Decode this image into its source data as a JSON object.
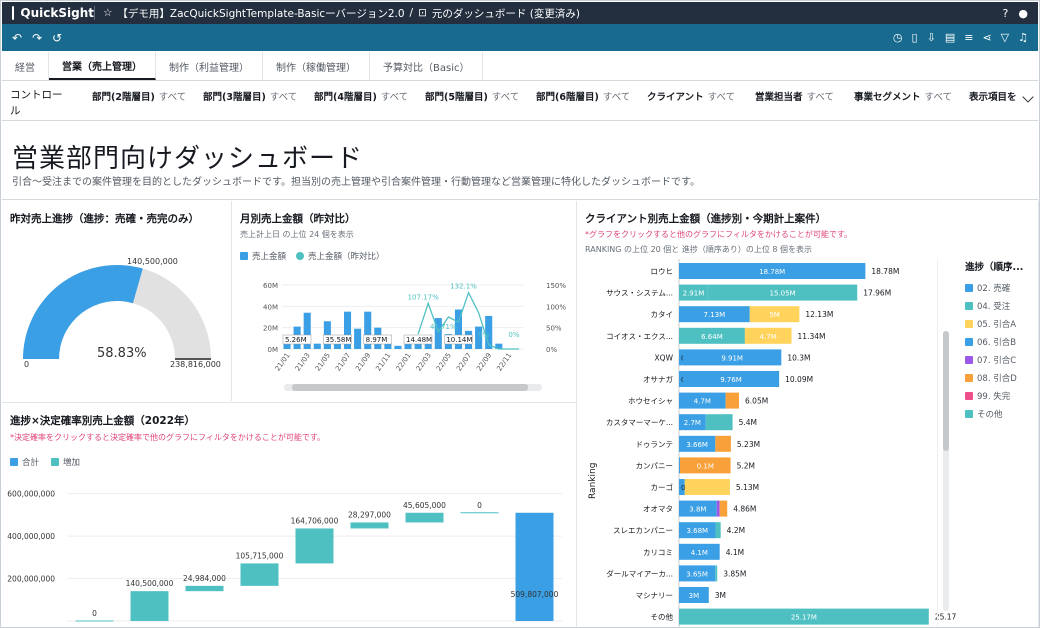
{
  "app": {
    "name": "QuickSight",
    "title": "【デモ用】ZacQuickSightTemplate-Basicーバージョン2.0",
    "view_label": "元のダッシュボード (変更済み)",
    "sep": "/"
  },
  "colors": {
    "blue": "#3a9fe4",
    "teal": "#4ec0c2",
    "yellow": "#ffd35c",
    "orange": "#f8a13a",
    "gray": "#e1e1e1",
    "pink": "#ef4f8b",
    "purple": "#9b59e8",
    "red": "#e64a4a"
  },
  "tabs": [
    {
      "label": "経営"
    },
    {
      "label": "営業（売上管理）"
    },
    {
      "label": "制作（利益管理）"
    },
    {
      "label": "制作（稼働管理）"
    },
    {
      "label": "予算対比（Basic）"
    }
  ],
  "controls": {
    "label": "コントロール",
    "items": [
      {
        "name": "部門(2階層目)",
        "value": "すべて"
      },
      {
        "name": "部門(3階層目)",
        "value": "すべて"
      },
      {
        "name": "部門(4階層目)",
        "value": "すべて"
      },
      {
        "name": "部門(5階層目)",
        "value": "すべて"
      },
      {
        "name": "部門(6階層目)",
        "value": "すべて"
      },
      {
        "name": "クライアント",
        "value": "すべて"
      },
      {
        "name": "営業担当者",
        "value": "すべて"
      },
      {
        "name": "事業セグメント",
        "value": "すべて"
      },
      {
        "name": "表示項目を",
        "value": ""
      }
    ]
  },
  "hero": {
    "title": "営業部門向けダッシュボード",
    "desc": "引合〜受注までの案件管理を目的としたダッシュボードです。担当別の売上管理や引合案件管理・行動管理など営業管理に特化したダッシュボードです。"
  },
  "gauge": {
    "title": "昨対売上進捗（進捗：売確・売完のみ）",
    "percent_label": "58.83%",
    "max_label": "140,500,000",
    "target_label": "238,816,000",
    "zero_label": "0",
    "fraction": 0.5883
  },
  "monthly": {
    "title": "月別売上金額（昨対比）",
    "subtitle": "売上計上日 の上位 24 個を表示",
    "legend": [
      "売上金額",
      "売上金額（昨対比）"
    ]
  },
  "waterfall": {
    "title": "進捗×決定確率別売上金額（2022年）",
    "note": "*決定確率をクリックすると決定確率で他のグラフにフィルタをかけることが可能です。",
    "legend": [
      "合計",
      "増加"
    ]
  },
  "client": {
    "title": "クライアント別売上金額（進捗別・今期計上案件）",
    "note": "*グラフをクリックすると他のグラフにフィルタをかけることが可能です。",
    "subtitle": "RANKING の上位 20 個と 進捗（順序あり）の上位 8 個を表示",
    "axis_label": "Ranking",
    "legend_title": "進捗（順序...",
    "legend": [
      {
        "name": "02. 売確",
        "color": "#3a9fe4"
      },
      {
        "name": "04. 受注",
        "color": "#4ec0c2"
      },
      {
        "name": "05. 引合A",
        "color": "#ffd35c"
      },
      {
        "name": "06. 引合B",
        "color": "#3a9fe4"
      },
      {
        "name": "07. 引合C",
        "color": "#9b59e8"
      },
      {
        "name": "08. 引合D",
        "color": "#f8a13a"
      },
      {
        "name": "99. 失完",
        "color": "#ef4f8b"
      },
      {
        "name": "その他",
        "color": "#4ec0c2"
      }
    ]
  },
  "chart_data": [
    {
      "type": "gauge",
      "title": "昨対売上進捗（進捗：売確・売完のみ）",
      "value": 140500000,
      "target": 238816000,
      "percent": 58.83
    },
    {
      "type": "bar",
      "title": "月別売上金額（昨対比）",
      "categories": [
        "21/01",
        "21/03",
        "21/05",
        "21/07",
        "21/09",
        "21/11",
        "22/01",
        "22/03",
        "22/05",
        "22/07",
        "22/09",
        "22/11"
      ],
      "series": [
        {
          "name": "売上金額",
          "values": [
            5,
            21,
            34,
            5,
            26,
            12,
            35,
            19,
            35,
            20,
            13,
            3,
            5,
            13,
            11,
            29,
            14,
            37,
            17,
            21,
            31,
            5,
            0,
            0
          ]
        },
        {
          "name": "売上金額（昨対比）",
          "values": [
            null,
            null,
            null,
            null,
            null,
            null,
            null,
            null,
            null,
            null,
            null,
            null,
            null,
            35,
            107.17,
            40,
            75,
            63,
            132.1,
            85,
            10,
            0,
            0,
            0
          ]
        }
      ],
      "bar_labels": [
        "5.26M",
        "35.58M",
        "8.97M",
        "14.48M",
        "10.14M"
      ],
      "line_labels": [
        "107.17%",
        "41.71%",
        "132.1%",
        "0%",
        "0%"
      ],
      "y_ticks": [
        "0M",
        "20M",
        "40M",
        "60M"
      ],
      "y2_ticks": [
        "0%",
        "50%",
        "100%",
        "150%"
      ],
      "ylim": [
        0,
        60
      ],
      "y2lim": [
        0,
        150
      ]
    },
    {
      "type": "bar",
      "title": "進捗×決定確率別売上金額（2022年）",
      "labels": [
        "0",
        "140,500,000",
        "24,984,000",
        "105,715,000",
        "164,706,000",
        "28,297,000",
        "45,605,000",
        "0",
        "509,807,000"
      ],
      "values": [
        0,
        140500000,
        24984000,
        105715000,
        164706000,
        28297000,
        45605000,
        0,
        509807000
      ],
      "y_ticks": [
        "200,000,000",
        "400,000,000",
        "600,000,000"
      ],
      "ylim": [
        0,
        650000000
      ]
    },
    {
      "type": "bar",
      "title": "クライアント別売上金額（進捗別・今期計上案件）",
      "categories": [
        "ロウヒ",
        "サウス・システム...",
        "カタイ",
        "コイオス・エクス...",
        "XQW",
        "オサナガ",
        "ホウセイシャ",
        "カスタマーマーケ...",
        "ドゥランテ",
        "カンパニー",
        "カーゴ",
        "オオマタ",
        "スレエカンパニー",
        "カリコミ",
        "ダールマイアーカ...",
        "マシナリー",
        "その他"
      ],
      "totals": [
        "18.78M",
        "17.96M",
        "12.13M",
        "11.34M",
        "10.3M",
        "10.09M",
        "6.05M",
        "5.4M",
        "5.23M",
        "5.2M",
        "5.13M",
        "4.86M",
        "4.2M",
        "4.1M",
        "3.85M",
        "3M",
        "25.17M"
      ],
      "segments": [
        [
          [
            "#3a9fe4",
            18.78,
            "18.78M"
          ]
        ],
        [
          [
            "#4ec0c2",
            2.91,
            "2.91M"
          ],
          [
            "#4ec0c2",
            15.05,
            "15.05M"
          ]
        ],
        [
          [
            "#3a9fe4",
            7.13,
            "7.13M"
          ],
          [
            "#ffd35c",
            5.0,
            "5M"
          ]
        ],
        [
          [
            "#4ec0c2",
            6.64,
            "6.64M"
          ],
          [
            "#ffd35c",
            4.7,
            "4.7M"
          ]
        ],
        [
          [
            "#3a9fe4",
            0.4,
            "0"
          ],
          [
            "#3a9fe4",
            9.91,
            "9.91M"
          ]
        ],
        [
          [
            "#3a9fe4",
            0.4,
            "0"
          ],
          [
            "#3a9fe4",
            9.69,
            "9.76M"
          ]
        ],
        [
          [
            "#3a9fe4",
            4.7,
            "4.7M"
          ],
          [
            "#f8a13a",
            1.35,
            ""
          ]
        ],
        [
          [
            "#3a9fe4",
            2.7,
            "2.7M"
          ],
          [
            "#4ec0c2",
            2.7,
            ""
          ]
        ],
        [
          [
            "#3a9fe4",
            3.66,
            "3.66M"
          ],
          [
            "#f8a13a",
            1.57,
            ""
          ]
        ],
        [
          [
            "#3a9fe4",
            0.1,
            ""
          ],
          [
            "#f8a13a",
            5.1,
            "0.1M"
          ]
        ],
        [
          [
            "#3a9fe4",
            0.58,
            "0.58M"
          ],
          [
            "#ffd35c",
            4.55,
            ""
          ]
        ],
        [
          [
            "#3a9fe4",
            3.8,
            "3.8M"
          ],
          [
            "#9b59e8",
            0.3,
            ""
          ],
          [
            "#f8a13a",
            0.76,
            ""
          ]
        ],
        [
          [
            "#3a9fe4",
            3.68,
            "3.68M"
          ],
          [
            "#4ec0c2",
            0.52,
            ""
          ]
        ],
        [
          [
            "#3a9fe4",
            4.1,
            "4.1M"
          ]
        ],
        [
          [
            "#3a9fe4",
            3.65,
            "3.65M"
          ],
          [
            "#4ec0c2",
            0.2,
            ""
          ]
        ],
        [
          [
            "#3a9fe4",
            3.0,
            "3M"
          ]
        ],
        [
          [
            "#4ec0c2",
            25.17,
            "25.17M"
          ]
        ]
      ]
    }
  ]
}
